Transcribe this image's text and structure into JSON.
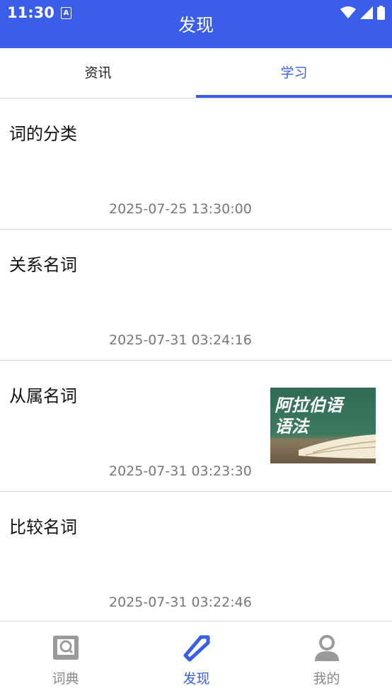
{
  "status_bar": {
    "time": "11:30",
    "notification_icon": "A"
  },
  "header": {
    "title": "发现"
  },
  "tabs": [
    {
      "label": "资讯",
      "active": false
    },
    {
      "label": "学习",
      "active": true
    }
  ],
  "articles": [
    {
      "title": "词的分类",
      "date": "2025-07-25 13:30:00"
    },
    {
      "title": "关系名词",
      "date": "2025-07-31 03:24:16"
    },
    {
      "title": "从属名词",
      "date": "2025-07-31 03:23:30",
      "thumbnail_text": "阿拉伯语\n语法"
    },
    {
      "title": "比较名词",
      "date": "2025-07-31 03:22:46"
    }
  ],
  "bottom_nav": [
    {
      "label": "词典",
      "icon": "dictionary-icon",
      "active": false
    },
    {
      "label": "发现",
      "icon": "discover-icon",
      "active": true
    },
    {
      "label": "我的",
      "icon": "profile-icon",
      "active": false
    }
  ],
  "colors": {
    "accent": "#3b5ee8",
    "muted": "#888888"
  }
}
